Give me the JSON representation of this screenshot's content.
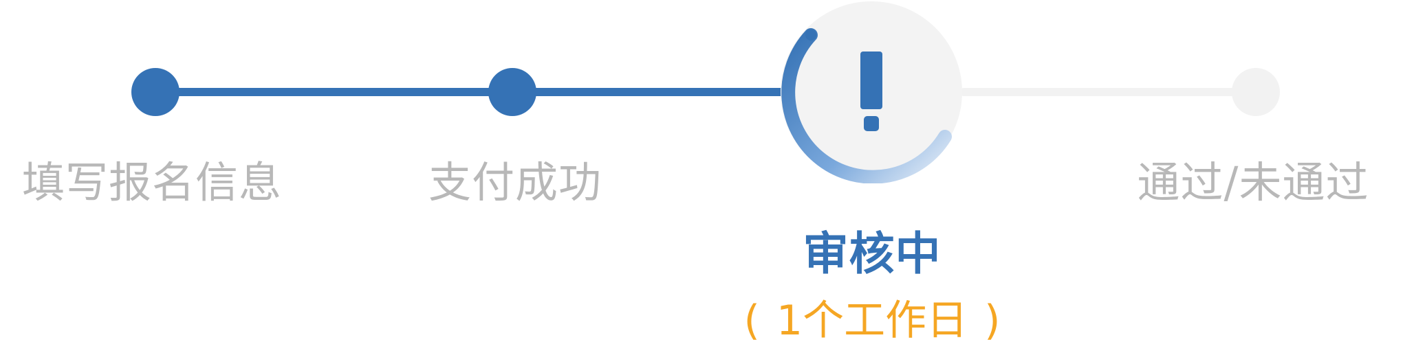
{
  "steps": [
    {
      "label": "填写报名信息",
      "status": "done"
    },
    {
      "label": "支付成功",
      "status": "done"
    },
    {
      "label": "审核中",
      "status": "current",
      "note": "1个工作日",
      "icon": "exclamation-icon"
    },
    {
      "label": "通过/未通过",
      "status": "pending"
    }
  ],
  "current_note": {
    "open": "(",
    "text": "1个工作日",
    "close": ")"
  },
  "colors": {
    "active": "#3572b5",
    "inactive_text": "#b8b8b8",
    "pending_track": "#f2f2f2",
    "note": "#f5a623"
  }
}
